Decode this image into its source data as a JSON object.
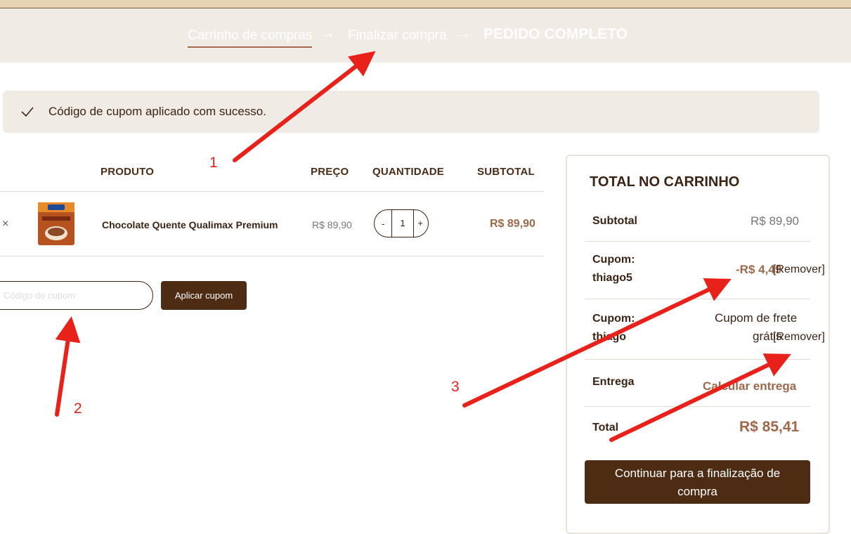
{
  "steps": [
    {
      "label": "Carrinho de compras"
    },
    {
      "label": "Finalizar compra"
    },
    {
      "label": "PEDIDO COMPLETO"
    }
  ],
  "step_arrow": "→",
  "notice": {
    "message": "Código de cupom aplicado com sucesso."
  },
  "table": {
    "headers": {
      "product": "PRODUTO",
      "price": "PREÇO",
      "quantity": "QUANTIDADE",
      "subtotal": "SUBTOTAL"
    },
    "row": {
      "remove": "×",
      "name": "Chocolate Quente Qualimax Premium",
      "price": "R$ 89,90",
      "qty_minus": "-",
      "qty_value": "1",
      "qty_plus": "+",
      "subtotal": "R$ 89,90"
    }
  },
  "coupon": {
    "placeholder": "Código do cupom",
    "apply_label": "Aplicar cupom"
  },
  "cart_totals": {
    "title": "TOTAL NO CARRINHO",
    "subtotal_label": "Subtotal",
    "subtotal_value": "R$ 89,90",
    "coupon1_label_a": "Cupom:",
    "coupon1_label_b": "thiago5",
    "coupon1_value": "-R$ 4,49",
    "coupon1_remove": "[Remover]",
    "coupon2_label_a": "Cupom:",
    "coupon2_label_b": "thiago",
    "coupon2_value_a": "Cupom de frete",
    "coupon2_value_b": "grátis",
    "coupon2_remove": "[Remover]",
    "shipping_label": "Entrega",
    "shipping_value": "Calcular entrega",
    "total_label": "Total",
    "total_value": "R$ 85,41",
    "checkout_label": "Continuar para a finalização de compra"
  },
  "annotations": {
    "a1": "1",
    "a2": "2",
    "a3": "3"
  },
  "colors": {
    "brown_dark": "#4d2c13",
    "accent": "#a0684a",
    "annotation_red": "#e8221b",
    "banner_bg": "#f1ebe6"
  }
}
